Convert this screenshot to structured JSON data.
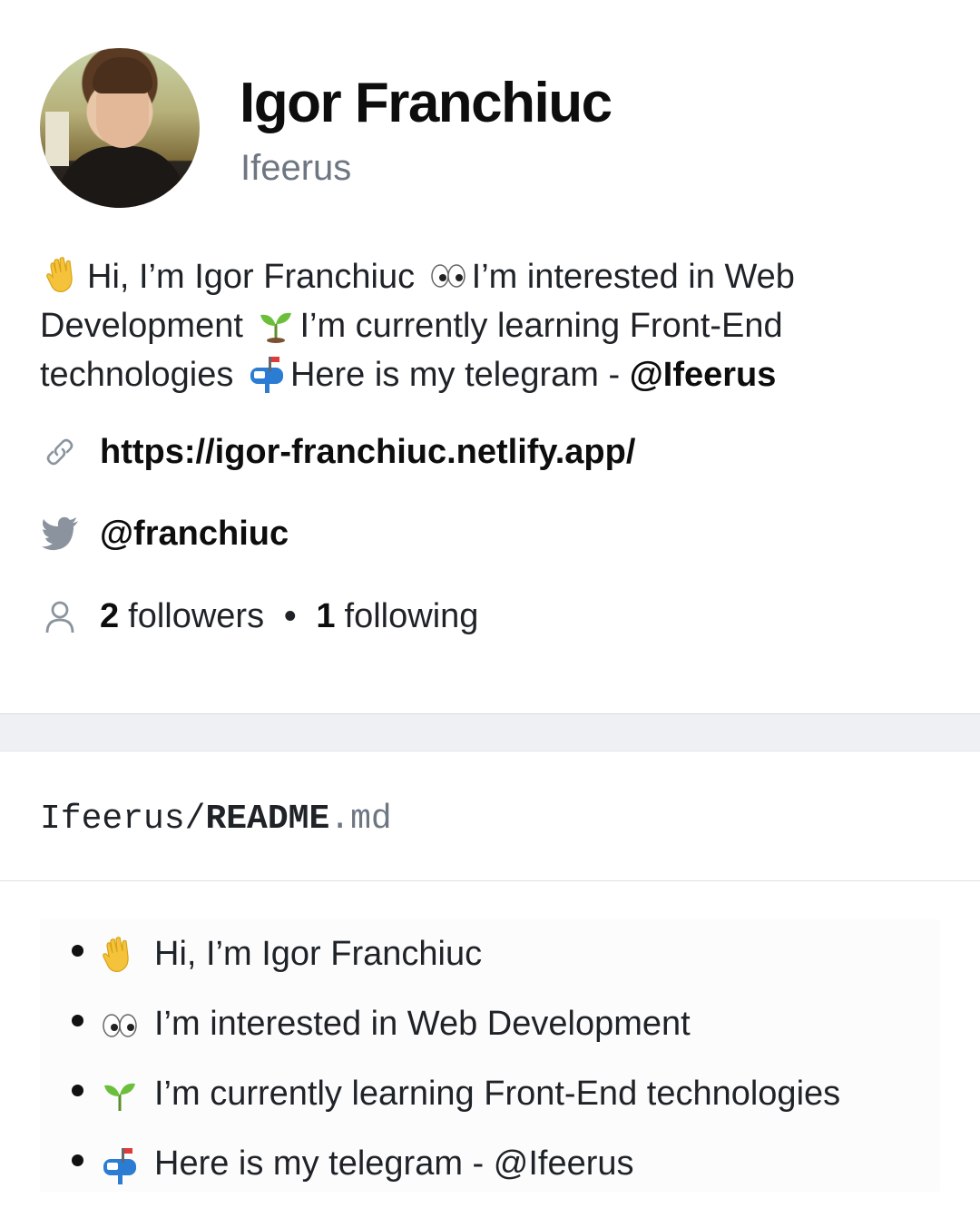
{
  "profile": {
    "name": "Igor Franchiuc",
    "login": "Ifeerus",
    "bio": {
      "part1": "Hi, I’m Igor Franchiuc",
      "part2": "I’m interested in Web Development",
      "part3": "I’m currently learning Front-End technologies",
      "part4": "Here is my telegram -",
      "handle": "@Ifeerus"
    },
    "website": "https://igor-franchiuc.netlify.app/",
    "twitter": "@franchiuc",
    "followers_count": "2",
    "followers_label": "followers",
    "following_count": "1",
    "following_label": "following"
  },
  "readme": {
    "owner": "Ifeerus/",
    "file": "README",
    "ext": ".md",
    "items": [
      {
        "emoji": "waving-hand",
        "text": "Hi, I’m Igor Franchiuc"
      },
      {
        "emoji": "eyes",
        "text": "I’m interested in Web Development"
      },
      {
        "emoji": "seedling",
        "text": "I’m currently learning Front-End technologies"
      },
      {
        "emoji": "mailbox",
        "text": "Here is my telegram - @Ifeerus"
      }
    ]
  },
  "icons": {
    "link": "link-icon",
    "twitter": "twitter-bird-icon",
    "people": "person-icon"
  },
  "colors": {
    "text": "#1f2328",
    "muted": "#6e7681",
    "twitter_icon": "#8b949e",
    "divider": "#eef0f3"
  }
}
